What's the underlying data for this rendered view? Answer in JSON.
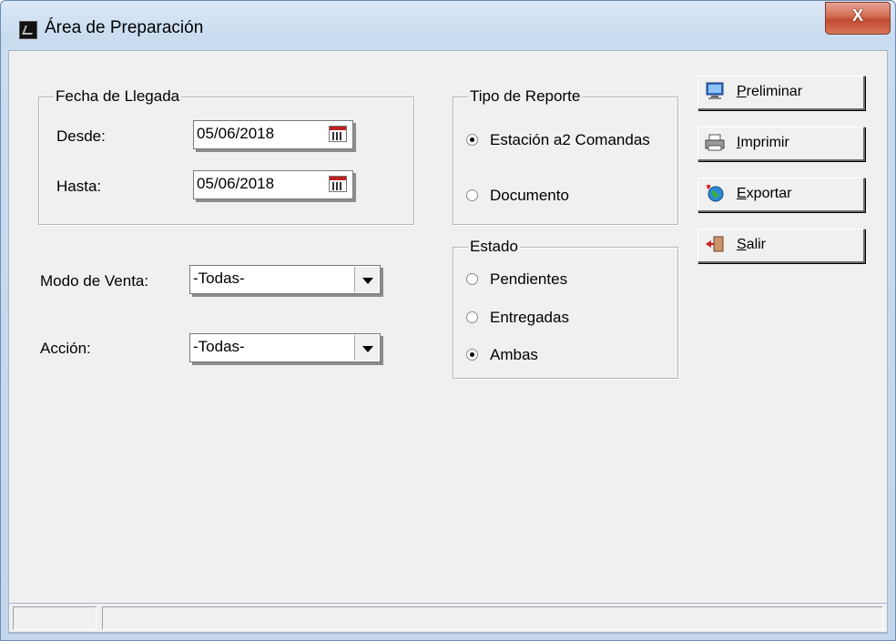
{
  "window": {
    "title": "Área de Preparación",
    "close_label": "X",
    "icon": "app-icon"
  },
  "fecha": {
    "legend": "Fecha de Llegada",
    "desde_label": "Desde:",
    "desde_value": "05/06/2018",
    "hasta_label": "Hasta:",
    "hasta_value": "05/06/2018",
    "picker_icon": "calendar-icon"
  },
  "modo_venta": {
    "label": "Modo de Venta:",
    "value": "-Todas-"
  },
  "accion": {
    "label": "Acción:",
    "value": "-Todas-"
  },
  "tipo_reporte": {
    "legend": "Tipo de Reporte",
    "options": [
      "Estación a2 Comandas",
      "Documento"
    ],
    "selected": "Estación a2 Comandas"
  },
  "estado": {
    "legend": "Estado",
    "options": [
      "Pendientes",
      "Entregadas",
      "Ambas"
    ],
    "selected": "Ambas"
  },
  "buttons": [
    {
      "key": "P",
      "rest": "reliminar",
      "icon": "monitor-icon"
    },
    {
      "key": "I",
      "rest": "mprimir",
      "icon": "printer-icon"
    },
    {
      "key": "E",
      "rest": "xportar",
      "icon": "globe-icon"
    },
    {
      "key": "S",
      "rest": "alir",
      "icon": "exit-door-icon"
    }
  ],
  "colors": {
    "close_button": "#c94a30",
    "client_bg": "#f0f0f0",
    "calendar_red": "#c02020"
  }
}
